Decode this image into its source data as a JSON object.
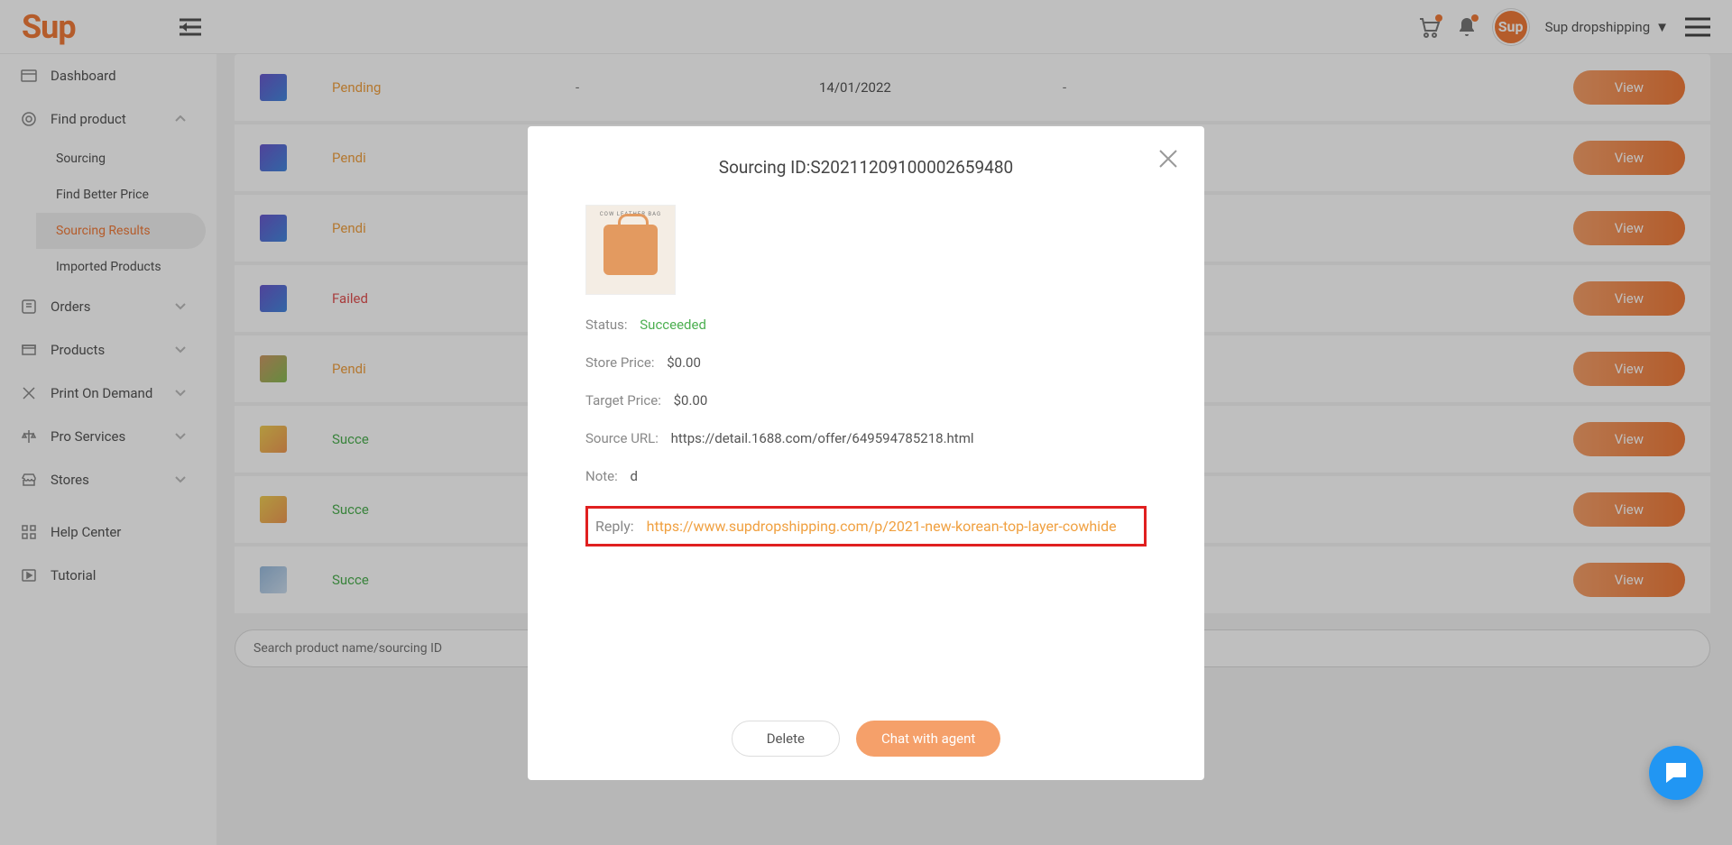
{
  "header": {
    "logo": "Sup",
    "user_label": "Sup dropshipping",
    "brand_badge": "Sup"
  },
  "sidebar": {
    "dashboard": "Dashboard",
    "findproduct": "Find product",
    "sub_sourcing": "Sourcing",
    "sub_fbp": "Find Better Price",
    "sub_results": "Sourcing Results",
    "sub_imported": "Imported Products",
    "orders": "Orders",
    "products": "Products",
    "pod": "Print On Demand",
    "pro": "Pro Services",
    "stores": "Stores",
    "help": "Help Center",
    "tutorial": "Tutorial"
  },
  "table": {
    "rows": [
      {
        "status_class": "st-pending",
        "status": "Pending",
        "date": "14/01/2022"
      },
      {
        "status_class": "st-pending",
        "status": "Pendi",
        "date": ""
      },
      {
        "status_class": "st-pending",
        "status": "Pendi",
        "date": ""
      },
      {
        "status_class": "st-failed",
        "status": "Failed",
        "date": ""
      },
      {
        "status_class": "st-pending",
        "status": "Pendi",
        "date": ""
      },
      {
        "status_class": "st-succeeded",
        "status": "Succe",
        "date": ""
      },
      {
        "status_class": "st-succeeded",
        "status": "Succe",
        "date": ""
      },
      {
        "status_class": "st-succeeded",
        "status": "Succe",
        "date": ""
      }
    ],
    "view_label": "View",
    "dash": "-",
    "search_placeholder": "Search product name/sourcing ID"
  },
  "modal": {
    "title": "Sourcing ID:S20211209100002659480",
    "img_cap": "COW LEATHER BAG",
    "status_label": "Status:",
    "status_val": "Succeeded",
    "store_price_label": "Store Price:",
    "store_price_val": "$0.00",
    "target_price_label": "Target Price:",
    "target_price_val": "$0.00",
    "source_url_label": "Source URL:",
    "source_url_val": "https://detail.1688.com/offer/649594785218.html",
    "note_label": "Note:",
    "note_val": "d",
    "reply_label": "Reply:",
    "reply_val": "https://www.supdropshipping.com/p/2021-new-korean-top-layer-cowhide",
    "delete": "Delete",
    "chat": "Chat with agent"
  }
}
